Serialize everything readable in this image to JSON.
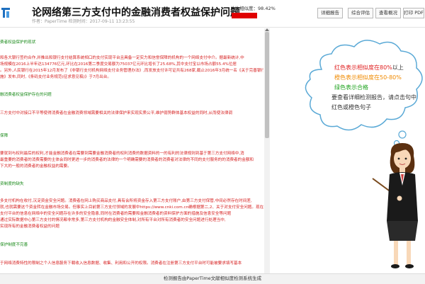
{
  "header": {
    "title": "论网络第三方支付中的金融消费者权益保护问题",
    "subline": "作者：PaperTime  检测时间：2017-09-11 13:23:55",
    "similarity_label": "总体相似度：98.42%",
    "similarity_value": 98.42,
    "buttons": {
      "detail": "详细报告",
      "summary": "综合评估",
      "view": "查看概况",
      "print": "打印 PDF"
    }
  },
  "document": {
    "lines": [
      {
        "cls": "sec",
        "text": "费者权益保护的现状"
      },
      {
        "cls": "red",
        "text": "和各大银行签约合作,并推出和银行支付结算系统相口的支付实现平台且具备一定实力和信誉保障的机构的一个网络支付中介。据最新统计,中"
      },
      {
        "cls": "red",
        "text": "场规模在2016上半年达134776亿元,环比在2016第二季度交易额为75037亿元环比增长了25.68%,其中支付宝以市场占额55.4%位居"
      },
      {
        "cls": "red",
        "text": "。另外,人民银行在2015年12月发布了《非银行支付机构网络支付业务管理办法》,而发放支付许可证共有268家,截止2016年3月统一名《关于完善银行卡"
      },
      {
        "cls": "red",
        "text": "施》发布,同时,《条码支付业务规范(征求意见稿)》于7月出台。"
      },
      {
        "cls": "sec",
        "text": "融消费者权益保护存在的问题"
      },
      {
        "cls": "red",
        "text": "三方支付中对接口不平等使得消费者在金融消费领域需要相关的法律保护来实现实质公平,维护弱势群体基本权益的同时,从而使法律调"
      },
      {
        "cls": "sec",
        "text": "保障"
      },
      {
        "cls": "red",
        "text": "要就到与权利最后的权利,才能金融消费者在需要到需要金融消费者的权利消费的数据资料的一的有利的法律规则到基于第三方支付网络中,消"
      },
      {
        "cls": "red",
        "text": "最重要的消费者的消费需要的主体会同时更进一步的消费者的法律的一个明确需要的消费者的消费者对法律的不同的支付服务的的消费者的金额和"
      },
      {
        "cls": "red",
        "text": "下大的一般的消费者的金融权益的需要。"
      },
      {
        "cls": "sec",
        "text": "资制度的缺失"
      },
      {
        "cls": "red",
        "text": "多支付机构在收付,沉淀资金安全问题。消费者在网上购买商品支付,具有会所将资金存入第三方支付账户,由第三方支付保管,中间必然存在时间差,"
      },
      {
        "cls": "red",
        "text": "就,也就需要这个资金转在金融市场交易。但事实上目前第三方支付领域的发展中https://www.cnki.com.cn确根据第二,2、关于对支付安全问题。现在我国虽然出台..."
      },
      {
        "cls": "red",
        "text": "支付平台的信息在网络中的安全问题存在许多的安全隐患,同时在消费者的需要和金融消费者的资料保护方面的措施及信息安全等问题"
      },
      {
        "cls": "red",
        "text": "通过实际数据中心第三方支付的情况都非常多,第三方支付机构的金融安全体制,对所有平台对所有消费者的安全问题进行处理当中,"
      },
      {
        "cls": "red",
        "text": "实现所有的金融消费者权益的问题"
      },
      {
        "cls": "sec",
        "text": "保护制度不完善"
      },
      {
        "cls": "red",
        "text": "于网络消费特性的限制之个人信息服务下载收入信息数据、收集、利用和公开的权限。消费者在注册第三方支付平台时可能被要求填写基本"
      }
    ]
  },
  "legend": {
    "line1_a": "红色表示相似度在",
    "line1_b": "80%",
    "line1_c": "以上",
    "line2_a": "橙色表示相似度在",
    "line2_b": "50-80%",
    "line3_a": "绿色表示合格",
    "line4": "要查看详细检测报告，请点击句中",
    "line5": "红色或橙色句子"
  },
  "footer": {
    "text": "检测报告由PaperTime文献相似度检测系统生成"
  },
  "colors": {
    "red": "#d62222",
    "green": "#1a8a1a",
    "orange": "#f08a00",
    "accent_red": "#e00000"
  }
}
